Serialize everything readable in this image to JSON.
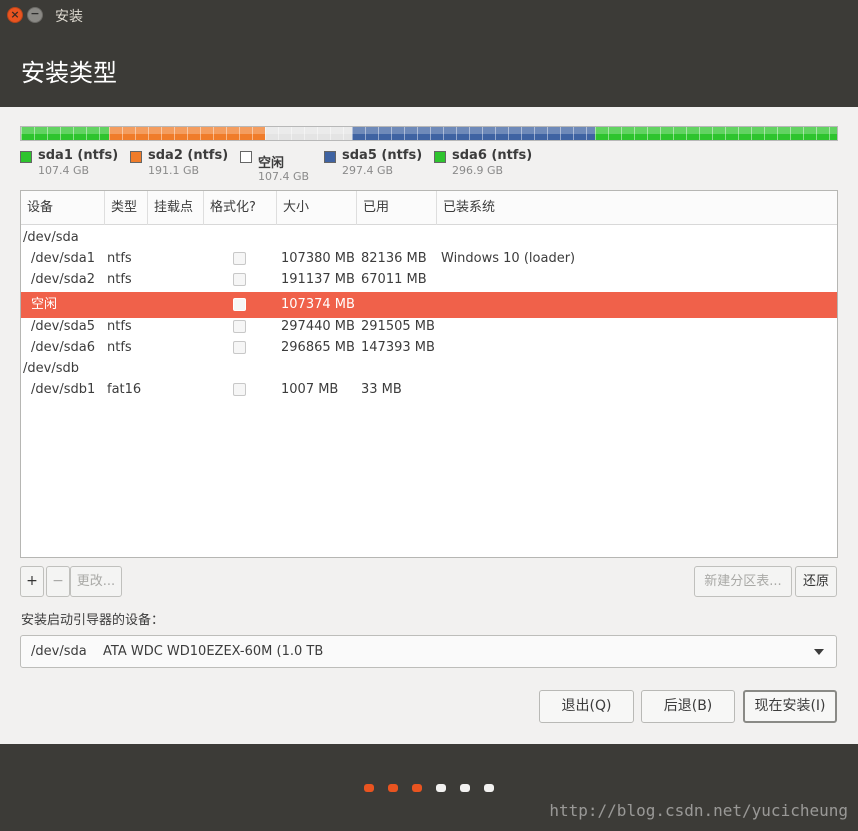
{
  "window": {
    "title": "安装",
    "close_glyph": "×",
    "min_glyph": "−"
  },
  "header": {
    "title": "安装类型"
  },
  "colors": {
    "ntfs_green": "#2ec42e",
    "orange": "#f07c2a",
    "free": "#e8e8e8",
    "blue": "#3f63a2",
    "selection": "#f0614a",
    "active_dot": "#e95420",
    "inactive_dot": "#f2f1f0"
  },
  "partition_bar": [
    {
      "name": "sda1",
      "color": "#2ec42e",
      "size_gb": 107.4
    },
    {
      "name": "sda2",
      "color": "#f07c2a",
      "size_gb": 191.1
    },
    {
      "name": "free",
      "color": "#e4e4e4",
      "size_gb": 107.4
    },
    {
      "name": "sda5",
      "color": "#3f63a2",
      "size_gb": 297.4
    },
    {
      "name": "sda6",
      "color": "#2ec42e",
      "size_gb": 296.9
    }
  ],
  "legend": [
    {
      "name": "sda1 (ntfs)",
      "size": "107.4 GB",
      "color": "#2ec42e"
    },
    {
      "name": "sda2 (ntfs)",
      "size": "191.1 GB",
      "color": "#f07c2a"
    },
    {
      "name": "空闲",
      "size": "107.4 GB",
      "color": "#ffffff"
    },
    {
      "name": "sda5 (ntfs)",
      "size": "297.4 GB",
      "color": "#3f63a2"
    },
    {
      "name": "sda6 (ntfs)",
      "size": "296.9 GB",
      "color": "#2ec42e"
    }
  ],
  "table": {
    "headers": [
      "设备",
      "类型",
      "挂载点",
      "格式化?",
      "大小",
      "已用",
      "已装系统"
    ],
    "rows": [
      {
        "device": "/dev/sda",
        "type": "",
        "mount": "",
        "format": false,
        "size": "",
        "used": "",
        "system": "",
        "group": true
      },
      {
        "device": "/dev/sda1",
        "type": "ntfs",
        "mount": "",
        "format": false,
        "size": "107380 MB",
        "used": "82136 MB",
        "system": "Windows 10 (loader)"
      },
      {
        "device": "/dev/sda2",
        "type": "ntfs",
        "mount": "",
        "format": false,
        "size": "191137 MB",
        "used": "67011 MB",
        "system": ""
      },
      {
        "device": "空闲",
        "type": "",
        "mount": "",
        "format": false,
        "size": "107374 MB",
        "used": "",
        "system": "",
        "selected": true
      },
      {
        "device": "/dev/sda5",
        "type": "ntfs",
        "mount": "",
        "format": false,
        "size": "297440 MB",
        "used": "291505 MB",
        "system": ""
      },
      {
        "device": "/dev/sda6",
        "type": "ntfs",
        "mount": "",
        "format": false,
        "size": "296865 MB",
        "used": "147393 MB",
        "system": ""
      },
      {
        "device": "/dev/sdb",
        "type": "",
        "mount": "",
        "format": false,
        "size": "",
        "used": "",
        "system": "",
        "group": true
      },
      {
        "device": "/dev/sdb1",
        "type": "fat16",
        "mount": "",
        "format": false,
        "size": "1007 MB",
        "used": "33 MB",
        "system": ""
      }
    ]
  },
  "toolbar": {
    "add": "+",
    "remove": "−",
    "change": "更改...",
    "new_table": "新建分区表...",
    "revert": "还原"
  },
  "bootloader": {
    "label": "安装启动引导器的设备：",
    "device": "/dev/sda",
    "model": "ATA WDC WD10EZEX-60M (1.0 TB"
  },
  "actions": {
    "quit": "退出(Q)",
    "back": "后退(B)",
    "install": "现在安装(I)"
  },
  "progress": {
    "total_steps": 6,
    "completed_steps": 3
  },
  "watermark": "http://blog.csdn.net/yucicheung"
}
